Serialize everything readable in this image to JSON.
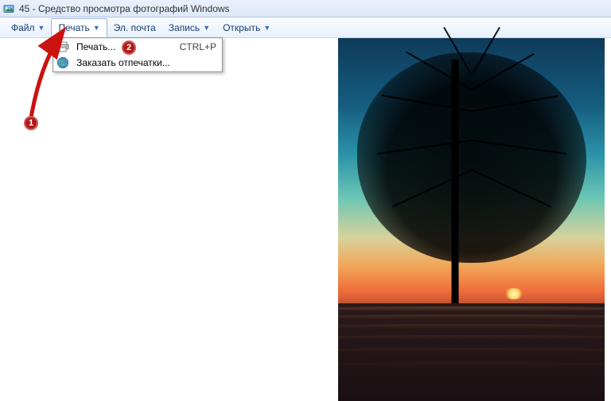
{
  "window": {
    "title": "45 - Средство просмотра фотографий Windows"
  },
  "toolbar": {
    "file": "Файл",
    "print": "Печать",
    "email": "Эл. почта",
    "burn": "Запись",
    "open": "Открыть"
  },
  "dropdown": {
    "print_label": "Печать...",
    "print_shortcut": "CTRL+P",
    "order_prints": "Заказать отпечатки..."
  },
  "annotations": {
    "badge1": "1",
    "badge2": "2"
  },
  "icons": {
    "app": "app-icon",
    "printer": "printer-icon",
    "globe": "globe-icon"
  }
}
